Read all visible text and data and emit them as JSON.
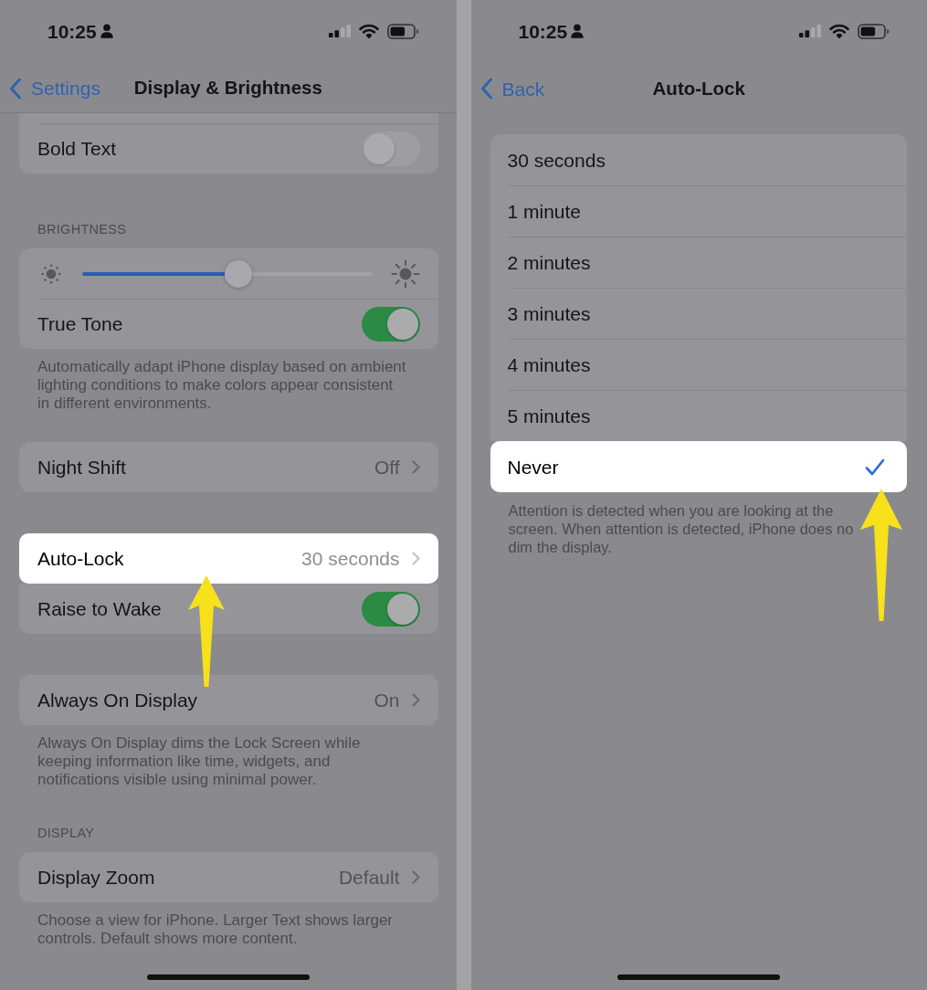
{
  "screens": [
    {
      "scrolled": true,
      "status_bar": {
        "time": "10:25"
      },
      "nav": {
        "back": "Settings",
        "title": "Display & Brightness"
      },
      "sections": [
        {
          "rows": [
            {
              "kind": "toggle",
              "label": "Bold Text",
              "on": false,
              "highlighted": false
            }
          ]
        },
        {
          "header": "BRIGHTNESS",
          "rows": [
            {
              "kind": "slider",
              "level": 0.54,
              "highlighted": false
            },
            {
              "kind": "toggle",
              "label": "True Tone",
              "on": true,
              "highlighted": false
            }
          ],
          "footer": "Automatically adapt iPhone display based on ambient\nlighting conditions to make colors appear consistent\nin different environments."
        },
        {
          "rows": [
            {
              "kind": "link",
              "label": "Night Shift",
              "value": "Off",
              "highlighted": false
            }
          ]
        },
        {
          "rows": [
            {
              "kind": "link",
              "label": "Auto-Lock",
              "value": "30 seconds",
              "highlighted": true
            },
            {
              "kind": "toggle",
              "label": "Raise to Wake",
              "on": true,
              "highlighted": false
            }
          ]
        },
        {
          "rows": [
            {
              "kind": "link",
              "label": "Always On Display",
              "value": "On",
              "highlighted": false
            }
          ],
          "footer": "Always On Display dims the Lock Screen while\nkeeping information like time, widgets, and\nnotifications visible using minimal power."
        },
        {
          "header": "DISPLAY",
          "rows": [
            {
              "kind": "link",
              "label": "Display Zoom",
              "value": "Default",
              "highlighted": false
            }
          ],
          "footer": "Choose a view for iPhone. Larger Text shows larger\ncontrols. Default shows more content."
        }
      ]
    },
    {
      "scrolled": false,
      "status_bar": {
        "time": "10:25"
      },
      "nav": {
        "back": "Back",
        "title": "Auto-Lock"
      },
      "sections": [
        {
          "rows": [
            {
              "kind": "option",
              "label": "30 seconds",
              "selected": false,
              "highlighted": false
            },
            {
              "kind": "option",
              "label": "1 minute",
              "selected": false,
              "highlighted": false
            },
            {
              "kind": "option",
              "label": "2 minutes",
              "selected": false,
              "highlighted": false
            },
            {
              "kind": "option",
              "label": "3 minutes",
              "selected": false,
              "highlighted": false
            },
            {
              "kind": "option",
              "label": "4 minutes",
              "selected": false,
              "highlighted": false
            },
            {
              "kind": "option",
              "label": "5 minutes",
              "selected": false,
              "highlighted": false
            },
            {
              "kind": "option",
              "label": "Never",
              "selected": true,
              "highlighted": true
            }
          ],
          "footer": "Attention is detected when you are looking at the\nscreen. When attention is detected, iPhone does no\ndim the display."
        }
      ]
    }
  ]
}
